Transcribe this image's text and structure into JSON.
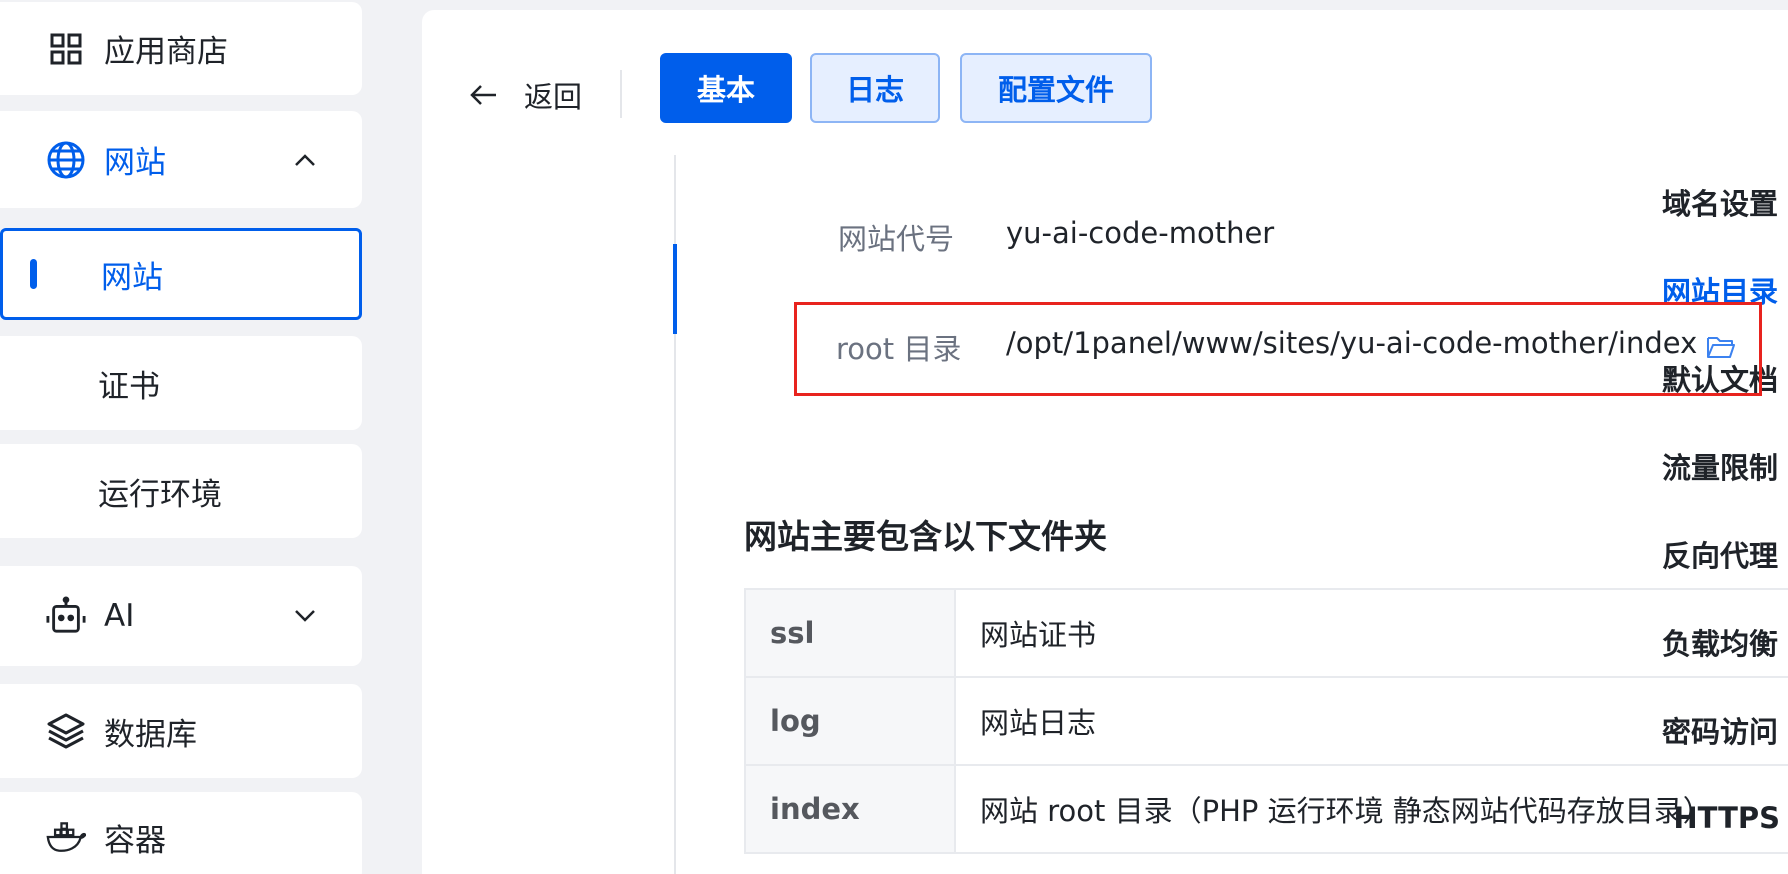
{
  "sidebar": {
    "items": [
      {
        "label": "应用商店",
        "icon": "grid-icon"
      },
      {
        "label": "网站",
        "icon": "globe-icon",
        "expanded": true
      },
      {
        "label": "网站",
        "active": true
      },
      {
        "label": "证书"
      },
      {
        "label": "运行环境"
      },
      {
        "label": "AI",
        "icon": "robot-icon",
        "expanded": false
      },
      {
        "label": "数据库",
        "icon": "layers-icon"
      },
      {
        "label": "容器",
        "icon": "docker-icon"
      }
    ]
  },
  "header": {
    "back_label": "返回",
    "tabs": [
      {
        "label": "基本",
        "active": true
      },
      {
        "label": "日志"
      },
      {
        "label": "配置文件"
      }
    ]
  },
  "subnav": {
    "items": [
      {
        "label": "域名设置"
      },
      {
        "label": "网站目录",
        "active": true
      },
      {
        "label": "默认文档"
      },
      {
        "label": "流量限制"
      },
      {
        "label": "反向代理"
      },
      {
        "label": "负载均衡"
      },
      {
        "label": "密码访问"
      },
      {
        "label": "HTTPS"
      }
    ]
  },
  "form": {
    "site_code_label": "网站代号",
    "site_code_value": "yu-ai-code-mother",
    "root_label": "root 目录",
    "root_value": "/opt/1panel/www/sites/yu-ai-code-mother/index"
  },
  "folders": {
    "title": "网站主要包含以下文件夹",
    "rows": [
      {
        "name": "ssl",
        "desc": "网站证书"
      },
      {
        "name": "log",
        "desc": "网站日志"
      },
      {
        "name": "index",
        "desc": "网站 root 目录（PHP 运行环境 静态网站代码存放目录）"
      }
    ]
  },
  "colors": {
    "accent": "#005eeb",
    "highlight_border": "#e8231e",
    "tab_plain_bg": "#e6efff"
  }
}
